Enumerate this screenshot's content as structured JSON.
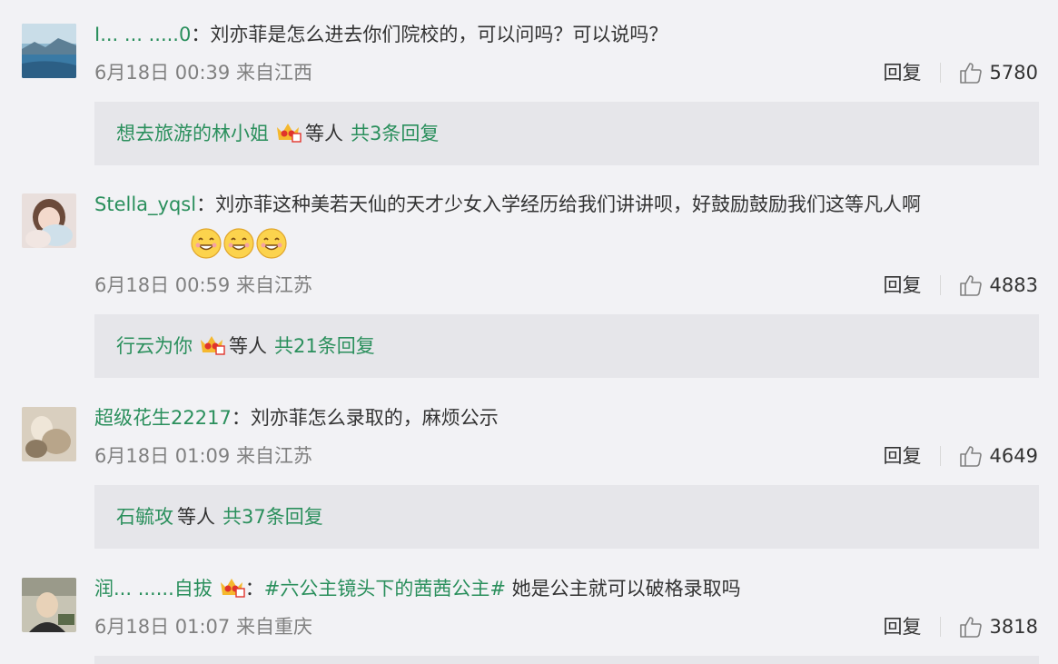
{
  "colors": {
    "link": "#2a8f5c",
    "text": "#333333",
    "meta": "#808080",
    "bg": "#f2f2f5",
    "reply_bg": "#e6e6ea"
  },
  "actions": {
    "reply_label": "回复",
    "like_icon": "thumbs-up-icon"
  },
  "comments": [
    {
      "username": "I... ... .....0",
      "text": "刘亦菲是怎么进去你们院校的，可以问吗？可以说吗？",
      "time": "6月18日 00:39 来自江西",
      "likes": "5780",
      "reply": {
        "name": "想去旅游的林小姐",
        "others": "等人",
        "total": "共3条回复"
      }
    },
    {
      "username": "Stella_yqsl",
      "text": "刘亦菲这种美若天仙的天才少女入学经历给我们讲讲呗，好鼓励鼓励我们这等凡人啊",
      "emoji_count": 3,
      "time": "6月18日 00:59 来自江苏",
      "likes": "4883",
      "reply": {
        "name": "行云为你",
        "others": "等人",
        "total": "共21条回复"
      }
    },
    {
      "username": "超级花生22217",
      "text": "刘亦菲怎么录取的，麻烦公示",
      "time": "6月18日 01:09 来自江苏",
      "likes": "4649",
      "reply": {
        "name": "石毓攻",
        "others": "等人",
        "total": "共37条回复"
      }
    },
    {
      "username": "润... ......自拔",
      "hashtag": "#六公主镜头下的茜茜公主#",
      "text": " 她是公主就可以破格录取吗",
      "time": "6月18日 01:07 来自重庆",
      "likes": "3818"
    }
  ]
}
